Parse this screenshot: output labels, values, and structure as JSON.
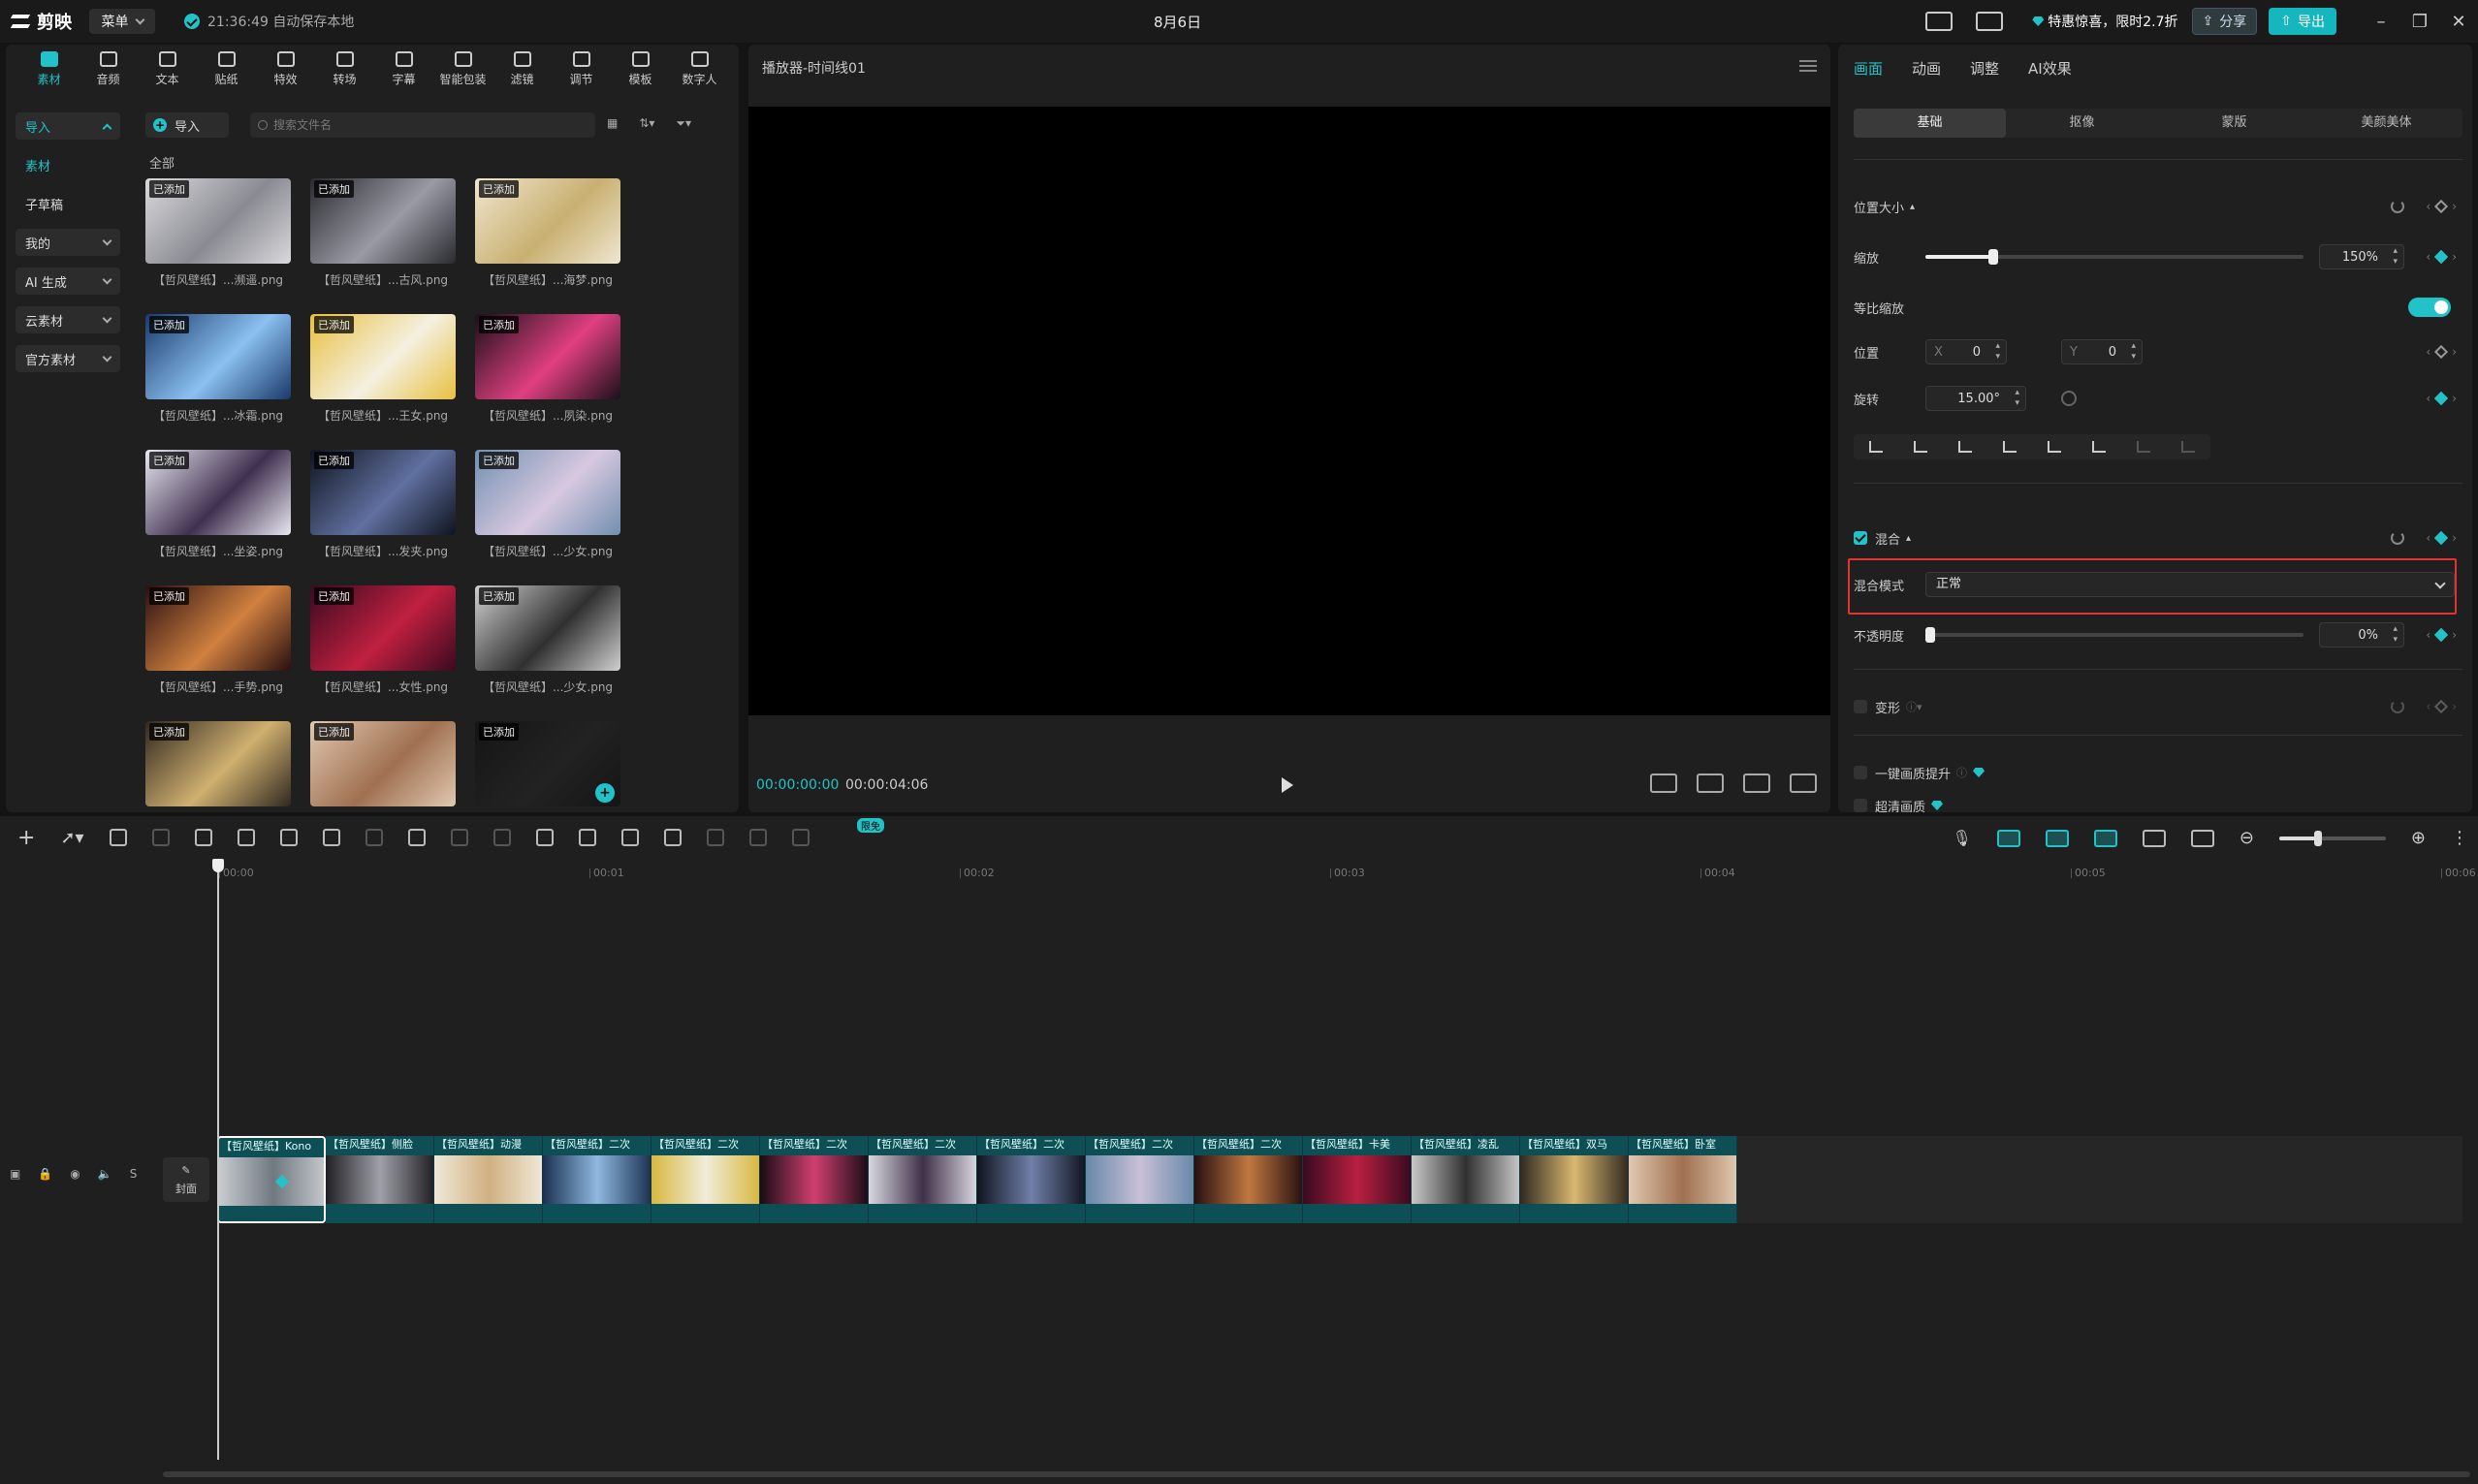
{
  "app": {
    "logo_text": "剪映",
    "menu_label": "菜单",
    "autosave": "21:36:49 自动保存本地",
    "title": "8月6日",
    "promo": "特惠惊喜，限时2.7折",
    "share_label": "分享",
    "export_label": "导出"
  },
  "category_tabs": [
    {
      "label": "素材",
      "icon": "media-icon"
    },
    {
      "label": "音频",
      "icon": "audio-icon"
    },
    {
      "label": "文本",
      "icon": "text-icon"
    },
    {
      "label": "贴纸",
      "icon": "sticker-icon"
    },
    {
      "label": "特效",
      "icon": "effects-icon"
    },
    {
      "label": "转场",
      "icon": "transition-icon"
    },
    {
      "label": "字幕",
      "icon": "subtitle-icon"
    },
    {
      "label": "智能包装",
      "icon": "smart-pack-icon"
    },
    {
      "label": "滤镜",
      "icon": "filter-icon"
    },
    {
      "label": "调节",
      "icon": "adjust-icon"
    },
    {
      "label": "模板",
      "icon": "template-icon"
    },
    {
      "label": "数字人",
      "icon": "avatar-icon"
    }
  ],
  "side_nav": {
    "import": "导入",
    "material": "素材",
    "draft": "子草稿",
    "mine": "我的",
    "ai": "AI 生成",
    "cloud": "云素材",
    "official": "官方素材"
  },
  "media": {
    "import_label": "导入",
    "search_placeholder": "搜索文件名",
    "all_label": "全部",
    "added_badge": "已添加",
    "items": [
      {
        "caption": "【哲风壁纸】...濒遥.png",
        "palette": [
          "#d9d9dd",
          "#8a8a92"
        ]
      },
      {
        "caption": "【哲风壁纸】...古风.png",
        "palette": [
          "#2a2a30",
          "#9a9aa4"
        ]
      },
      {
        "caption": "【哲风壁纸】...海梦.png",
        "palette": [
          "#f0e6d0",
          "#c8b070"
        ]
      },
      {
        "caption": "【哲风壁纸】...冰霜.png",
        "palette": [
          "#1a3a6a",
          "#8ac0f0"
        ]
      },
      {
        "caption": "【哲风壁纸】...王女.png",
        "palette": [
          "#e8c040",
          "#f4f0e0"
        ]
      },
      {
        "caption": "【哲风壁纸】...夙染.png",
        "palette": [
          "#1a1018",
          "#e04080"
        ]
      },
      {
        "caption": "【哲风壁纸】...坐姿.png",
        "palette": [
          "#e8e8f0",
          "#403050"
        ]
      },
      {
        "caption": "【哲风壁纸】...发夹.png",
        "palette": [
          "#101420",
          "#6070a0"
        ]
      },
      {
        "caption": "【哲风壁纸】...少女.png",
        "palette": [
          "#7090b0",
          "#d8c8e0"
        ]
      },
      {
        "caption": "【哲风壁纸】...手势.png",
        "palette": [
          "#2a1010",
          "#d08040"
        ]
      },
      {
        "caption": "【哲风壁纸】...女性.png",
        "palette": [
          "#3a0a20",
          "#c02040"
        ]
      },
      {
        "caption": "【哲风壁纸】...少女.png",
        "palette": [
          "#d0d0d0",
          "#303030"
        ]
      },
      {
        "caption": "",
        "palette": [
          "#302820",
          "#d0b070"
        ]
      },
      {
        "caption": "",
        "palette": [
          "#e0c8b0",
          "#a07050"
        ]
      },
      {
        "caption": "",
        "palette": [
          "#151515",
          "#222222"
        ]
      }
    ]
  },
  "player": {
    "title": "播放器-时间线01",
    "timecode_current": "00:00:00:00",
    "timecode_total": "00:00:04:06"
  },
  "props": {
    "tabs": [
      "画面",
      "动画",
      "调整",
      "AI效果"
    ],
    "subtabs": [
      "基础",
      "抠像",
      "蒙版",
      "美颜美体"
    ],
    "position_size": "位置大小",
    "scale_label": "缩放",
    "scale_value": "150%",
    "scale_fraction": 0.18,
    "uniform_scale": "等比缩放",
    "position_label": "位置",
    "x_label": "X",
    "x_value": "0",
    "y_label": "Y",
    "y_value": "0",
    "rotate_label": "旋转",
    "rotate_value": "15.00°",
    "blend_label": "混合",
    "blend_mode_label": "混合模式",
    "blend_mode_value": "正常",
    "opacity_label": "不透明度",
    "opacity_value": "0%",
    "opacity_fraction": 0.0,
    "deform_label": "变形",
    "enhance_label": "一键画质提升",
    "hd_label": "超清画质",
    "accent": "#21c3c8",
    "highlight": "#e23232"
  },
  "timeline": {
    "free_badge": "限免",
    "cover_label": "封面",
    "ruler": [
      "00:00",
      "00:01",
      "00:02",
      "00:03",
      "00:04",
      "00:05",
      "00:06"
    ],
    "clips": [
      {
        "label": "【哲风壁纸】Kono",
        "palette": [
          "#c8ccd0",
          "#707880"
        ]
      },
      {
        "label": "【哲风壁纸】侧脸",
        "palette": [
          "#202024",
          "#a0a0a8"
        ]
      },
      {
        "label": "【哲风壁纸】动漫",
        "palette": [
          "#f0e8d8",
          "#d0b080"
        ]
      },
      {
        "label": "【哲风壁纸】二次",
        "palette": [
          "#1a3050",
          "#90b8e0"
        ]
      },
      {
        "label": "【哲风壁纸】二次",
        "palette": [
          "#d8b840",
          "#f0ecd8"
        ]
      },
      {
        "label": "【哲风壁纸】二次",
        "palette": [
          "#180c14",
          "#d04070"
        ]
      },
      {
        "label": "【哲风壁纸】二次",
        "palette": [
          "#d8d8e0",
          "#403048"
        ]
      },
      {
        "label": "【哲风壁纸】二次",
        "palette": [
          "#101420",
          "#7080a8"
        ]
      },
      {
        "label": "【哲风壁纸】二次",
        "palette": [
          "#6888a8",
          "#c8c0d8"
        ]
      },
      {
        "label": "【哲风壁纸】二次",
        "palette": [
          "#281010",
          "#c07840"
        ]
      },
      {
        "label": "【哲风壁纸】卡美",
        "palette": [
          "#380a20",
          "#b82040"
        ]
      },
      {
        "label": "【哲风壁纸】凌乱",
        "palette": [
          "#c8c8c8",
          "#303030"
        ]
      },
      {
        "label": "【哲风壁纸】双马",
        "palette": [
          "#302820",
          "#d8b870"
        ]
      },
      {
        "label": "【哲风壁纸】卧室",
        "palette": [
          "#e0c8b0",
          "#a07050"
        ]
      }
    ]
  }
}
